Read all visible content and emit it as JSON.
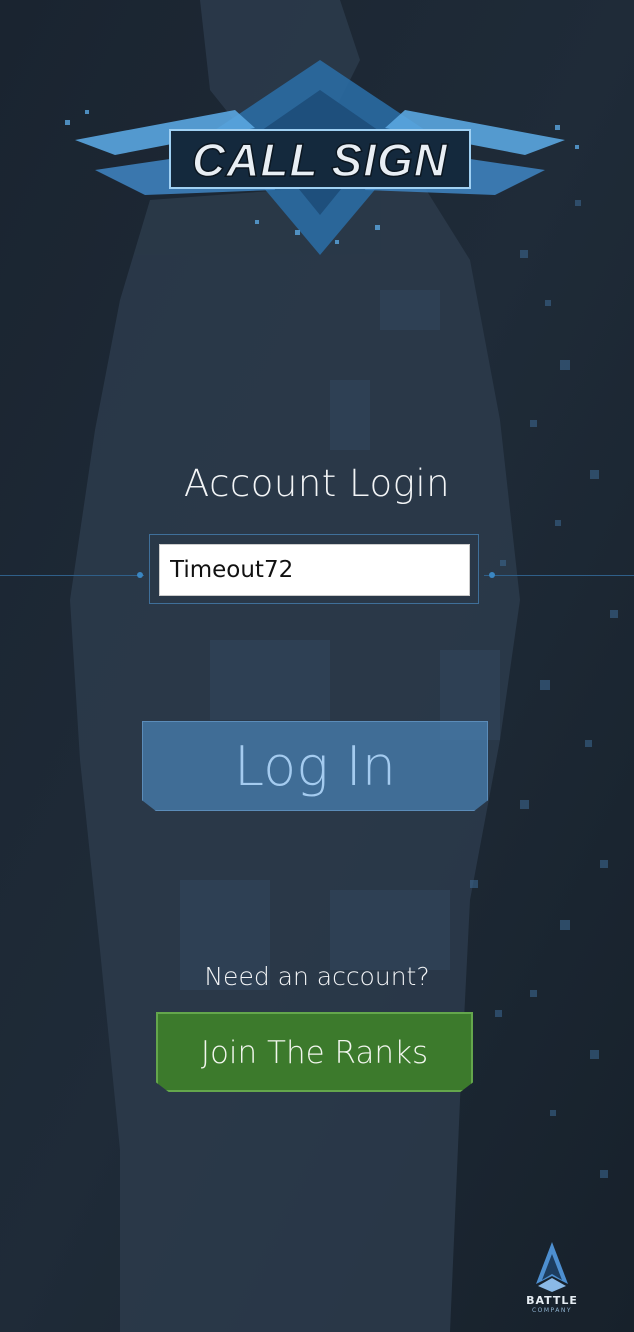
{
  "brand": {
    "logo_text": "CALL SIGN",
    "publisher_name": "BATTLE",
    "publisher_sub": "COMPANY"
  },
  "login": {
    "title": "Account Login",
    "username_value": "Timeout72",
    "login_button": "Log In"
  },
  "signup": {
    "prompt": "Need an account?",
    "join_button": "Join The Ranks"
  },
  "colors": {
    "background": "#1c2733",
    "accent_blue": "#467aaa",
    "accent_green": "#3c7a2c"
  }
}
